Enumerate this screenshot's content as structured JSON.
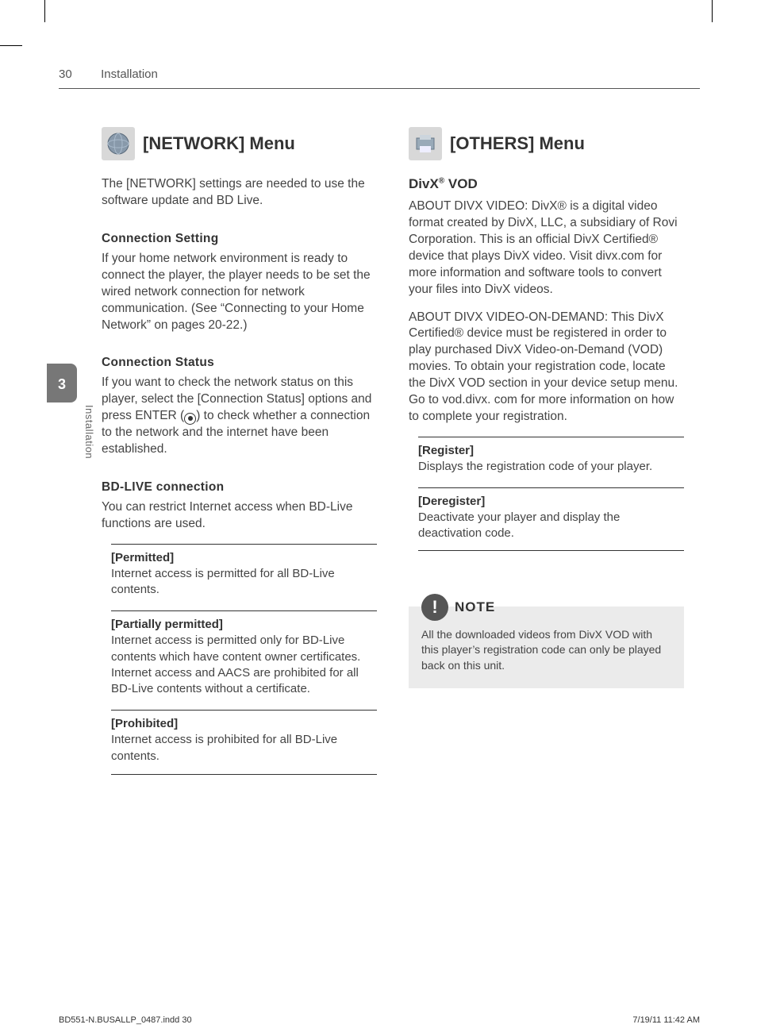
{
  "header": {
    "page_number": "30",
    "section": "Installation"
  },
  "side_tab": {
    "number": "3",
    "label": "Installation"
  },
  "left_column": {
    "menu_title": "[NETWORK] Menu",
    "intro": "The [NETWORK] settings are needed to use the software update and BD Live.",
    "sections": [
      {
        "heading": "Connection Setting",
        "body": "If your home network environment is ready to connect the player, the player needs to be set the wired network connection for network communication. (See “Connecting to your Home Network” on pages 20-22.)"
      },
      {
        "heading": "Connection Status",
        "body_before_icon": "If you want to check the network status on this player, select the [Connection Status] options and press ENTER (",
        "body_after_icon": ") to check whether a connection to the network and the internet have been established."
      },
      {
        "heading": "BD-LIVE connection",
        "body": "You can restrict Internet access when BD-Live functions are used.",
        "options": [
          {
            "title": "[Permitted]",
            "text": "Internet access is permitted for all BD-Live contents."
          },
          {
            "title": "[Partially permitted]",
            "text": "Internet access is permitted only for BD-Live contents which have content owner certificates. Internet access and AACS are prohibited for all BD-Live contents without a certificate."
          },
          {
            "title": "[Prohibited]",
            "text": "Internet access is prohibited for all BD-Live contents."
          }
        ]
      }
    ]
  },
  "right_column": {
    "menu_title": "[OTHERS] Menu",
    "divx": {
      "heading_prefix": "DivX",
      "heading_sup": "®",
      "heading_suffix": " VOD",
      "para1": "ABOUT DIVX VIDEO: DivX® is a digital video format created by DivX, LLC, a subsidiary of Rovi Corporation. This is an official DivX Certified® device that plays DivX video. Visit divx.com for more information and software tools to convert your files into DivX videos.",
      "para2": "ABOUT DIVX VIDEO-ON-DEMAND: This DivX Certified® device must be registered in order to play purchased DivX Video-on-Demand (VOD) movies. To obtain your registration code, locate the DivX VOD section in your device setup menu. Go to vod.divx. com for more information on how to complete your registration.",
      "options": [
        {
          "title": "[Register]",
          "text": "Displays the registration code of your player."
        },
        {
          "title": "[Deregister]",
          "text": "Deactivate your player and display the deactivation code."
        }
      ]
    },
    "note": {
      "label": "NOTE",
      "text": "All the downloaded videos from DivX VOD with this player’s registration code can only be played back on this unit."
    }
  },
  "footer": {
    "left": "BD551-N.BUSALLP_0487.indd   30",
    "right": "7/19/11   11:42 AM"
  }
}
